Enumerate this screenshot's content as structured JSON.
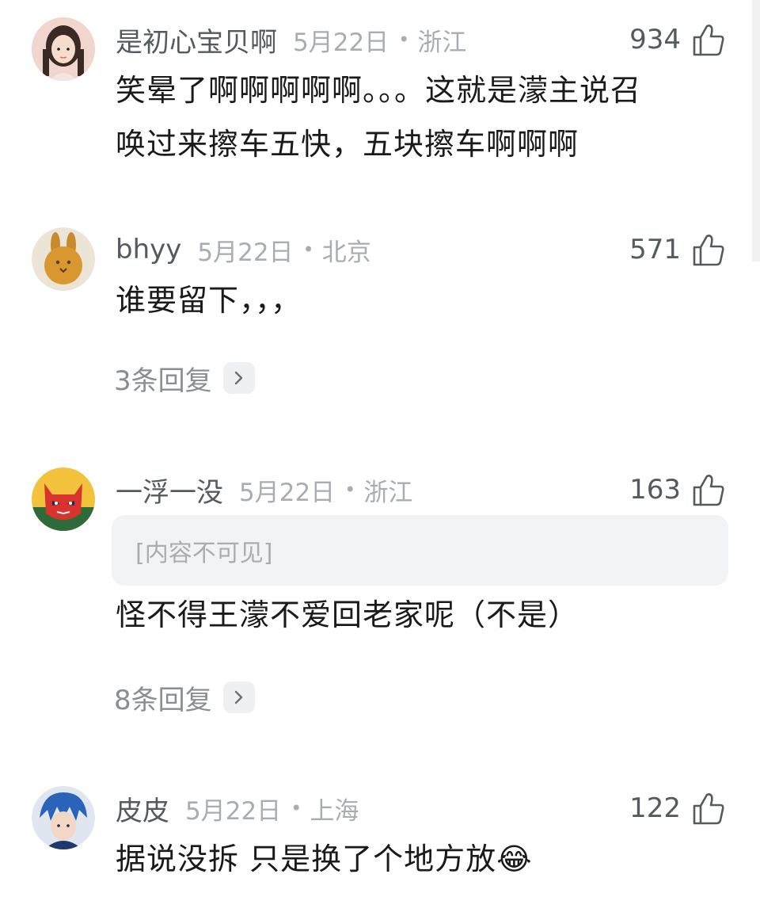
{
  "comments": [
    {
      "username": "是初心宝贝啊",
      "date": "5月22日",
      "separator": "•",
      "location": "浙江",
      "likes": "934",
      "text_lines": [
        "笑晕了啊啊啊啊啊。。。这就是濛主说召",
        "唤过来擦车五快，五块擦车啊啊啊"
      ]
    },
    {
      "username": "bhyy",
      "date": "5月22日",
      "separator": "•",
      "location": "北京",
      "likes": "571",
      "text": "谁要留下，，，",
      "replies": "3条回复"
    },
    {
      "username": "一浮一没",
      "date": "5月22日",
      "separator": "•",
      "location": "浙江",
      "likes": "163",
      "quoted": "[内容不可见]",
      "text": "怪不得王濛不爱回老家呢（不是）",
      "replies": "8条回复"
    },
    {
      "username": "皮皮",
      "date": "5月22日",
      "separator": "•",
      "location": "上海",
      "likes": "122",
      "text": "据说没拆 只是换了个地方放",
      "emoji": "😂"
    }
  ],
  "icons": {
    "like": "thumbs-up-outline-icon",
    "chevron": "chevron-right-icon"
  },
  "colors": {
    "username": "#555a60",
    "meta": "#a9adb2",
    "body": "#1a1a1a",
    "reply_link": "#8a8e93",
    "quote_bg": "#f2f3f5"
  }
}
